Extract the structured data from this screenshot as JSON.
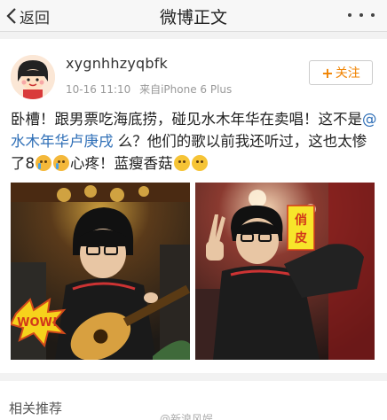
{
  "nav": {
    "back_label": "返回",
    "title": "微博正文"
  },
  "post": {
    "username": "xygnhhzyqbfk",
    "time": "10-16 11:10",
    "source": "来自iPhone 6 Plus",
    "follow_label": "关注",
    "text_part1": "卧槽！跟男票吃海底捞，碰见水木年华在卖唱！这不是",
    "mention": "@水木年华卢庚戌",
    "text_part2": " 么？他们的歌以前我还听过，这也太惨了8",
    "text_part3": "心疼！蓝瘦香菇",
    "images": [
      {
        "caption": "WOW!"
      },
      {
        "caption": "俏皮"
      }
    ]
  },
  "related": {
    "title": "相关推荐"
  },
  "watermark": "@新浪风娱"
}
